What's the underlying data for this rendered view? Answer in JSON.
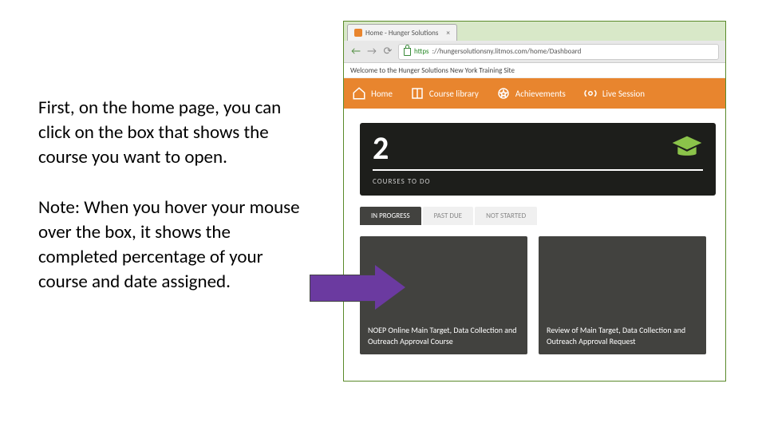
{
  "left": {
    "p1": "First, on the home page, you can click on the box that shows the course you want to open.",
    "p2": "Note: When you hover your mouse over the box, it shows the completed percentage of your course and date assigned."
  },
  "browser": {
    "tab_title": "Home - Hunger Solutions",
    "url_https": "https",
    "url_rest": "://hungersolutionsny.litmos.com/home/Dashboard",
    "welcome": "Welcome to the Hunger Solutions New York Training Site"
  },
  "nav": {
    "home": "Home",
    "library": "Course library",
    "achievements": "Achievements",
    "live": "Live Session"
  },
  "stat": {
    "number": "2",
    "label": "COURSES TO DO"
  },
  "tabs": {
    "in_progress": "IN PROGRESS",
    "past_due": "PAST DUE",
    "not_started": "NOT STARTED"
  },
  "cards": {
    "c1": "NOEP Online Main Target, Data Collection and Outreach Approval Course",
    "c2": "Review of Main Target, Data Collection and Outreach Approval Request"
  }
}
